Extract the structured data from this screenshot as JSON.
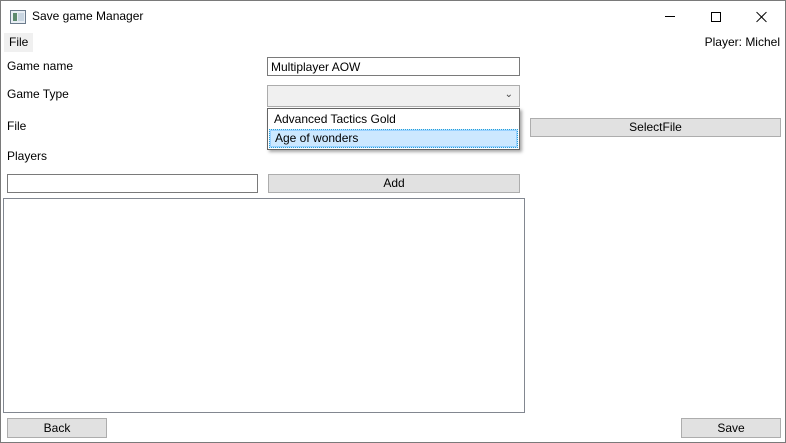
{
  "window": {
    "title": "Save game Manager",
    "icon": "app-window-icon"
  },
  "menu": {
    "file_label": "File"
  },
  "player": {
    "label": "Player:",
    "name": "Michel"
  },
  "form": {
    "game_name_label": "Game name",
    "game_name_value": "Multiplayer AOW",
    "game_type_label": "Game Type",
    "game_type_value": "",
    "file_label": "File",
    "players_label": "Players",
    "player_input_value": ""
  },
  "game_type_options": [
    "Advanced Tactics Gold",
    "Age of wonders"
  ],
  "game_type_highlighted": "Age of wonders",
  "buttons": {
    "select_file": "SelectFile",
    "add": "Add",
    "back": "Back",
    "save": "Save"
  },
  "players_list": []
}
